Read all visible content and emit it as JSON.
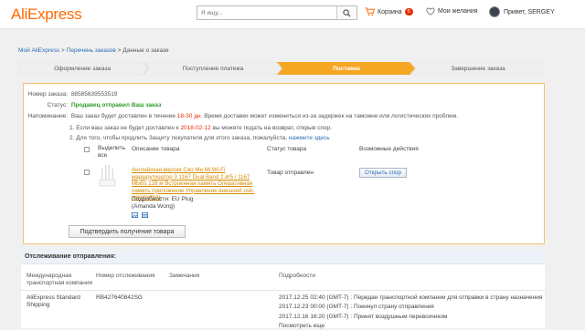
{
  "header": {
    "logo": "AliExpress",
    "search_placeholder": "Я ищу...",
    "cart_label": "Корзина",
    "cart_count": "0",
    "wishlist_label": "Мои желания",
    "greeting": "Привет, SERGEY"
  },
  "breadcrumb": {
    "link1": "Мой AliExpress",
    "sep1": " > ",
    "link2": "Перечень заказов",
    "sep2": " > ",
    "current": "Данные о заказе"
  },
  "steps": [
    {
      "label": "Оформление заказа",
      "state": "done"
    },
    {
      "label": "Поступление платежа",
      "state": "done"
    },
    {
      "label": "Поставка",
      "state": "current"
    },
    {
      "label": "Завершение заказа",
      "state": "todo"
    }
  ],
  "order": {
    "number_label": "Номер заказа:",
    "number": "88585639553519",
    "status_label": "Статус:",
    "status": "Продавец отправил Ваш заказ",
    "reminder_label": "Напоминание:",
    "reminder_pre": "Ваш заказ будет доставлен в течение ",
    "reminder_days": "18-30 дн.",
    "reminder_post": " Время доставки может измениться из-за задержек на таможне или логистических проблем.",
    "note1_pre": "1. Если ваш заказ не будет доставлен к ",
    "note1_date": "2018-02-12",
    "note1_post": " вы можете подать на возврат, открыв спор.",
    "note2_pre": "2. Для того, чтобы продлить Защиту покупателя для этого заказа, пожалуйста, ",
    "note2_link": "нажмите здесь"
  },
  "table": {
    "col_select": "Выделить\nвсе",
    "col_desc": "Описание товара",
    "col_status": "Статус товара",
    "col_actions": "Возможные действия"
  },
  "product": {
    "title": "Английская версия Сяо Ми Mi Wi-Fi маршрутизатор 3 1167 Dual Band 2.4/5 / 1167 Mbit/s 128 м Встроенная память Оперативная память приложение Управление внешней usb-накопитель",
    "props_label": "Подробности:",
    "props_value": "EU Plug",
    "seller": "(Amanda Wong)",
    "status": "Товар отправлен",
    "dispute_button": "Открыть спор"
  },
  "confirm_button": "Подтвердить получение товара",
  "tracking": {
    "title": "Отслеживание отправления:",
    "col_carrier": "Международная\nтранспортная компания",
    "col_number": "Номер отслеживания",
    "col_notes": "Замечания",
    "col_details": "Подробности",
    "carrier": "AliExpress Standard\nShipping",
    "tracking_number": "RB427640842SG",
    "events": [
      "2017.12.25 02:40 (GMT-7) : Передан транспортной компании для отправки в страну назначения",
      "2017.12.23 00:00 (GMT-7) : Покинул страну отправления",
      "2017.12.16 16:20 (GMT-7) : Принят воздушным перевозчиком"
    ],
    "more_link": "Посмотреть еще"
  },
  "colors": {
    "brand": "#ff6a00",
    "step_done": "#f0f0f0",
    "step_current": "#f5a623",
    "status_green": "#2d9b27",
    "link_blue": "#2a6eb5"
  }
}
